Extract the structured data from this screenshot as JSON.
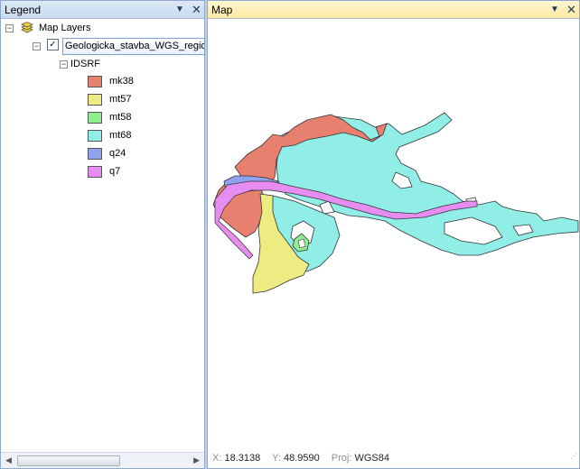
{
  "legend": {
    "title": "Legend",
    "tree": {
      "root_label": "Map Layers",
      "layer_name": "Geologicka_stavba_WGS_region",
      "field_label": "IDSRF",
      "classes": [
        {
          "label": "mk38",
          "color": "#e8806f"
        },
        {
          "label": "mt57",
          "color": "#ecec82"
        },
        {
          "label": "mt58",
          "color": "#8fee8f"
        },
        {
          "label": "mt68",
          "color": "#90eee6"
        },
        {
          "label": "q24",
          "color": "#8fa2ee"
        },
        {
          "label": "q7",
          "color": "#e78cf0"
        }
      ]
    }
  },
  "map": {
    "title": "Map",
    "status": {
      "x_label": "X:",
      "x_value": "18.3138",
      "y_label": "Y:",
      "y_value": "48.9590",
      "proj_label": "Proj:",
      "proj_value": "WGS84"
    }
  }
}
